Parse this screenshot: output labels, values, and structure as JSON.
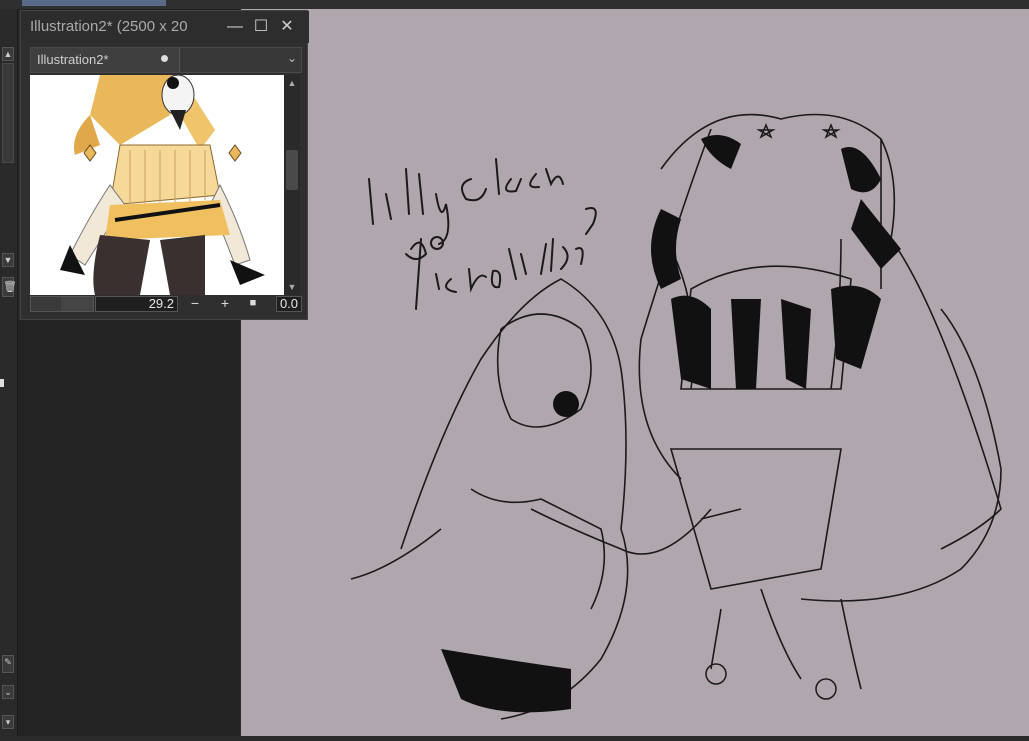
{
  "navigator": {
    "title": "Illustration2* (2500 x 20",
    "tab_label": "Illustration2*",
    "zoom_value": "29.2",
    "rotation_value": "0.0",
    "zoom_out_icon": "minus-icon",
    "zoom_in_icon": "plus-icon",
    "fit_icon": "square-icon"
  },
  "window_controls": {
    "minimize": "minimize-icon",
    "maximize": "maximize-icon",
    "close": "close-icon"
  },
  "canvas": {
    "handwritten_text": [
      "Lilly cleaning",
      "Pierrot's blade?"
    ],
    "background_color": "#b0a7ae"
  },
  "left_strip_icons": [
    "trash-icon",
    "brush-icon",
    "chevron-down-icon"
  ]
}
